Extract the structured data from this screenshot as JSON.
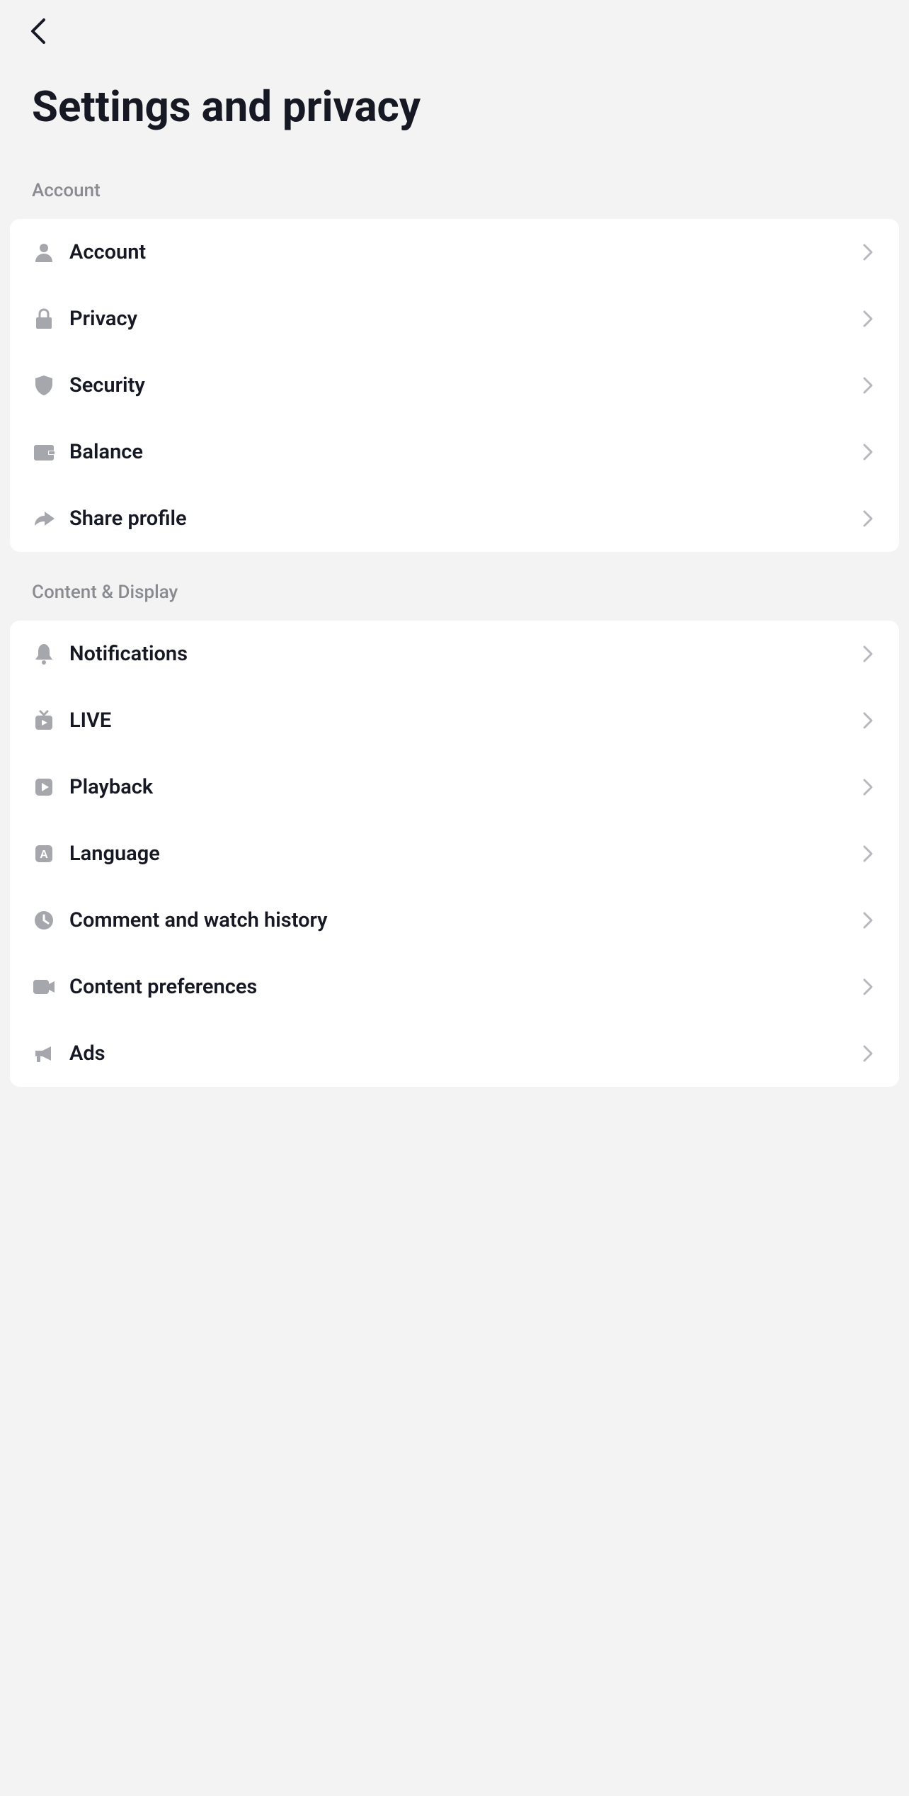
{
  "header": {
    "title": "Settings and privacy"
  },
  "sections": [
    {
      "title": "Account",
      "items": [
        {
          "icon": "user",
          "label": "Account"
        },
        {
          "icon": "lock",
          "label": "Privacy"
        },
        {
          "icon": "shield",
          "label": "Security"
        },
        {
          "icon": "wallet",
          "label": "Balance"
        },
        {
          "icon": "share",
          "label": "Share profile"
        }
      ]
    },
    {
      "title": "Content & Display",
      "items": [
        {
          "icon": "bell",
          "label": "Notifications"
        },
        {
          "icon": "live",
          "label": "LIVE"
        },
        {
          "icon": "play",
          "label": "Playback"
        },
        {
          "icon": "language",
          "label": "Language"
        },
        {
          "icon": "clock",
          "label": "Comment and watch history"
        },
        {
          "icon": "camera",
          "label": "Content preferences"
        },
        {
          "icon": "megaphone",
          "label": "Ads"
        }
      ]
    }
  ]
}
